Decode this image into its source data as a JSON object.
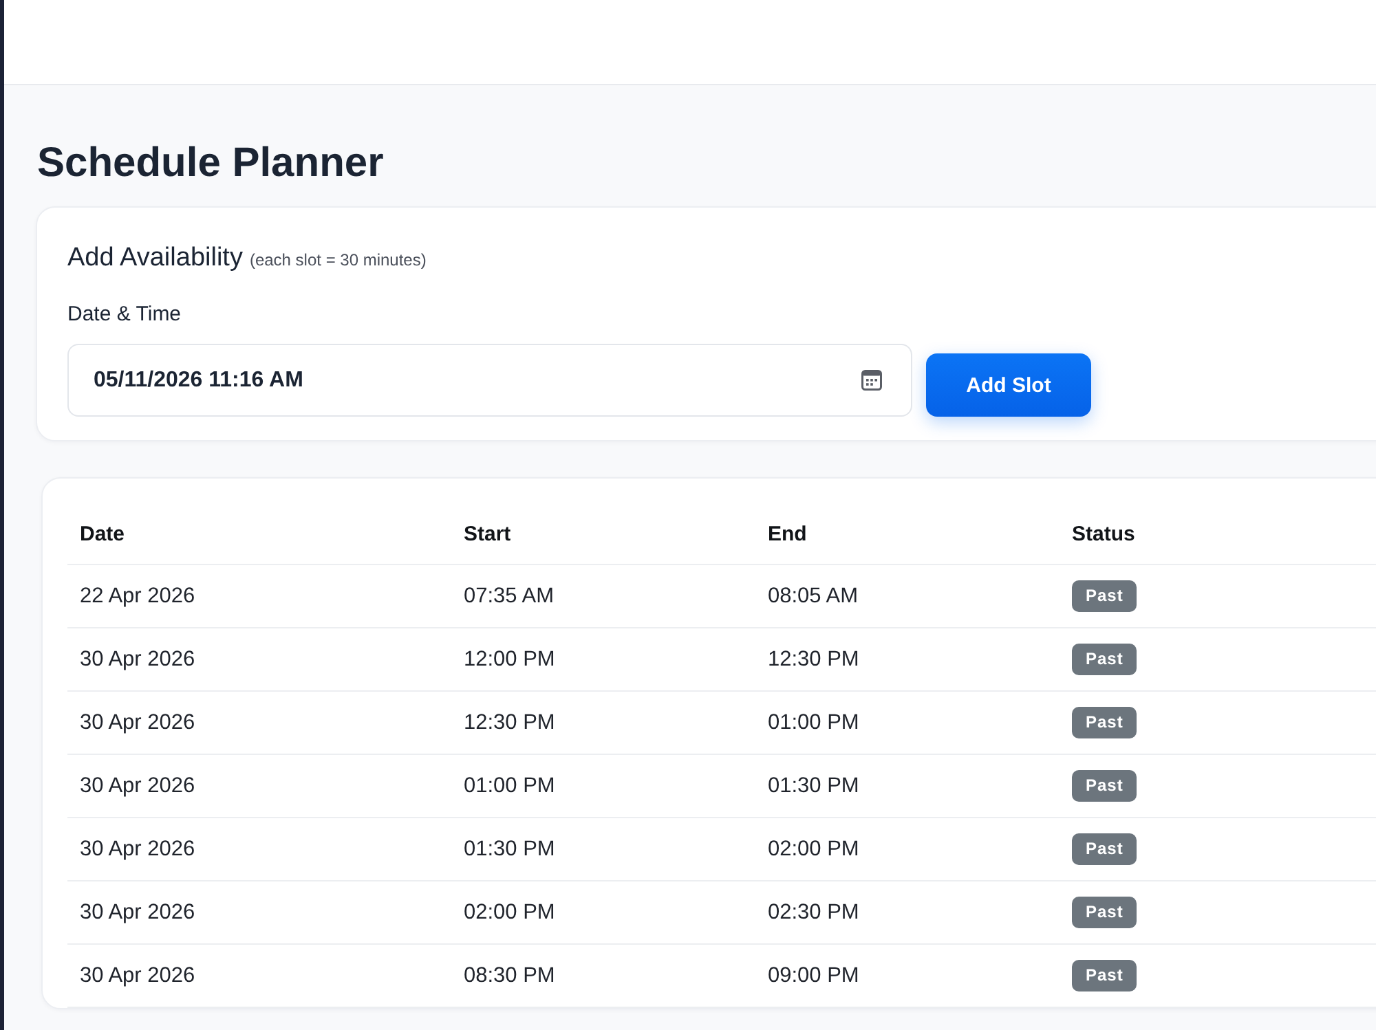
{
  "page": {
    "title": "Schedule Planner"
  },
  "availability_form": {
    "title": "Add Availability",
    "note": "(each slot = 30 minutes)",
    "field_label": "Date & Time",
    "datetime_value": "05/11/2026 11:16 AM",
    "submit_button": "Add Slot"
  },
  "slots_table": {
    "columns": [
      "Date",
      "Start",
      "End",
      "Status"
    ],
    "rows": [
      {
        "date": "22 Apr 2026",
        "start": "07:35 AM",
        "end": "08:05 AM",
        "status": {
          "label": "Past",
          "kind": "past"
        }
      },
      {
        "date": "30 Apr 2026",
        "start": "12:00 PM",
        "end": "12:30 PM",
        "status": {
          "label": "Past",
          "kind": "past"
        }
      },
      {
        "date": "30 Apr 2026",
        "start": "12:30 PM",
        "end": "01:00 PM",
        "status": {
          "label": "Past",
          "kind": "past"
        }
      },
      {
        "date": "30 Apr 2026",
        "start": "01:00 PM",
        "end": "01:30 PM",
        "status": {
          "label": "Past",
          "kind": "past"
        }
      },
      {
        "date": "30 Apr 2026",
        "start": "01:30 PM",
        "end": "02:00 PM",
        "status": {
          "label": "Past",
          "kind": "past"
        }
      },
      {
        "date": "30 Apr 2026",
        "start": "02:00 PM",
        "end": "02:30 PM",
        "status": {
          "label": "Past",
          "kind": "past"
        }
      },
      {
        "date": "30 Apr 2026",
        "start": "08:30 PM",
        "end": "09:00 PM",
        "status": {
          "label": "Past",
          "kind": "past"
        }
      }
    ]
  }
}
